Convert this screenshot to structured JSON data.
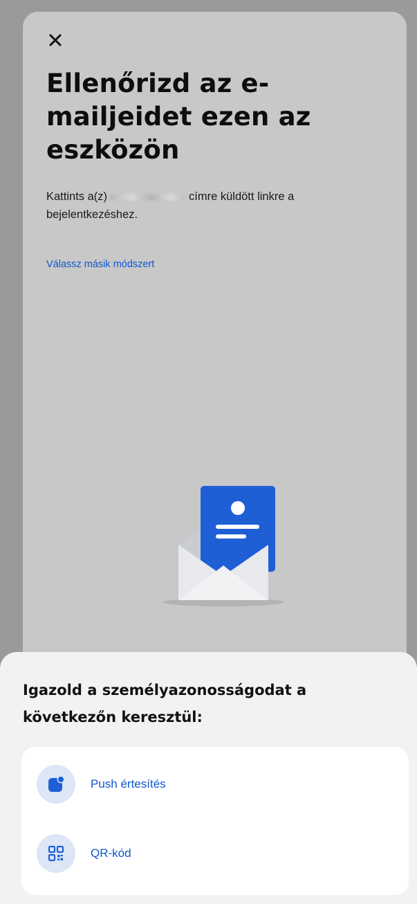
{
  "header": {
    "close_icon": "close-icon",
    "title": "Ellenőrizd az e-mailjeidet ezen az eszközön"
  },
  "body": {
    "description_prefix": "Kattints a(z)",
    "description_suffix": "címre küldött linkre a bejelentkezéshez.",
    "alt_method_link": "Válassz másik módszert",
    "illustration": "envelope-illustration"
  },
  "verify_sheet": {
    "title": "Igazold a személyazonosságodat a következőn keresztül:",
    "options": [
      {
        "label": "Push értesítés",
        "icon": "push-notification-icon"
      },
      {
        "label": "QR-kód",
        "icon": "qr-code-icon"
      }
    ]
  },
  "colors": {
    "link": "#0b57d0",
    "icon_bg": "#dce6f5",
    "envelope_blue": "#1f5fd6"
  }
}
